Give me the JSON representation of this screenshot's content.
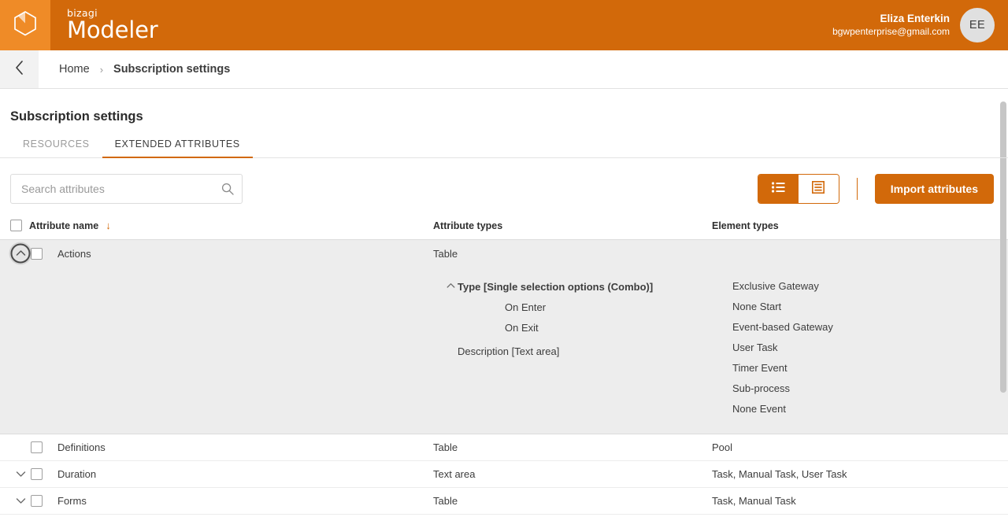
{
  "header": {
    "logo_icon": "cube-logo-icon",
    "brand_sub": "bizagi",
    "brand_main": "Modeler",
    "user_name": "Eliza Enterkin",
    "user_email": "bgwpenterprise@gmail.com",
    "avatar_initials": "EE",
    "bg_color": "#D2690A",
    "logo_bg_color": "#EF8B27"
  },
  "breadcrumb": {
    "back_icon": "chevron-left-icon",
    "items": [
      {
        "label": "Home"
      },
      {
        "label": "Subscription settings"
      }
    ],
    "separator": "›"
  },
  "page": {
    "title": "Subscription settings"
  },
  "tabs": [
    {
      "label": "RESOURCES",
      "active": false
    },
    {
      "label": "EXTENDED ATTRIBUTES",
      "active": true
    }
  ],
  "toolbar": {
    "search_placeholder": "Search attributes",
    "search_value": "",
    "search_icon": "search-icon",
    "view_list_icon": "list-view-icon",
    "view_table_icon": "table-view-icon",
    "view_list_active": true,
    "import_label": "Import attributes",
    "accent_color": "#D2690A"
  },
  "table": {
    "headers": {
      "select_all": "select-all-checkbox",
      "attribute_name": "Attribute name",
      "sort_icon": "sort-descending-arrow-icon",
      "attribute_types": "Attribute types",
      "element_types": "Element types"
    },
    "rows": [
      {
        "name": "Actions",
        "attribute_type": "Table",
        "element_type": "",
        "expanded": true,
        "toggle_icon": "chevron-up-icon",
        "toggle_hovered": true,
        "detail": {
          "attributes": [
            {
              "label": "Type [Single selection options (Combo)]",
              "level": 0,
              "chevron": "chevron-up-icon"
            },
            {
              "label": "On Enter",
              "level": 1,
              "chevron": ""
            },
            {
              "label": "On Exit",
              "level": 1,
              "chevron": ""
            },
            {
              "label": "Description [Text area]",
              "level": 0,
              "chevron": ""
            }
          ],
          "element_types": [
            "Exclusive Gateway",
            "None Start",
            "Event-based Gateway",
            "User Task",
            "Timer Event",
            "Sub-process",
            "None Event"
          ]
        }
      },
      {
        "name": "Definitions",
        "attribute_type": "Table",
        "element_type": "Pool",
        "expanded": false,
        "toggle_icon": ""
      },
      {
        "name": "Duration",
        "attribute_type": "Text area",
        "element_type": "Task,  Manual Task,  User Task",
        "expanded": false,
        "toggle_icon": "chevron-down-icon"
      },
      {
        "name": "Forms",
        "attribute_type": "Table",
        "element_type": "Task,  Manual Task",
        "expanded": false,
        "toggle_icon": "chevron-down-icon"
      }
    ]
  }
}
